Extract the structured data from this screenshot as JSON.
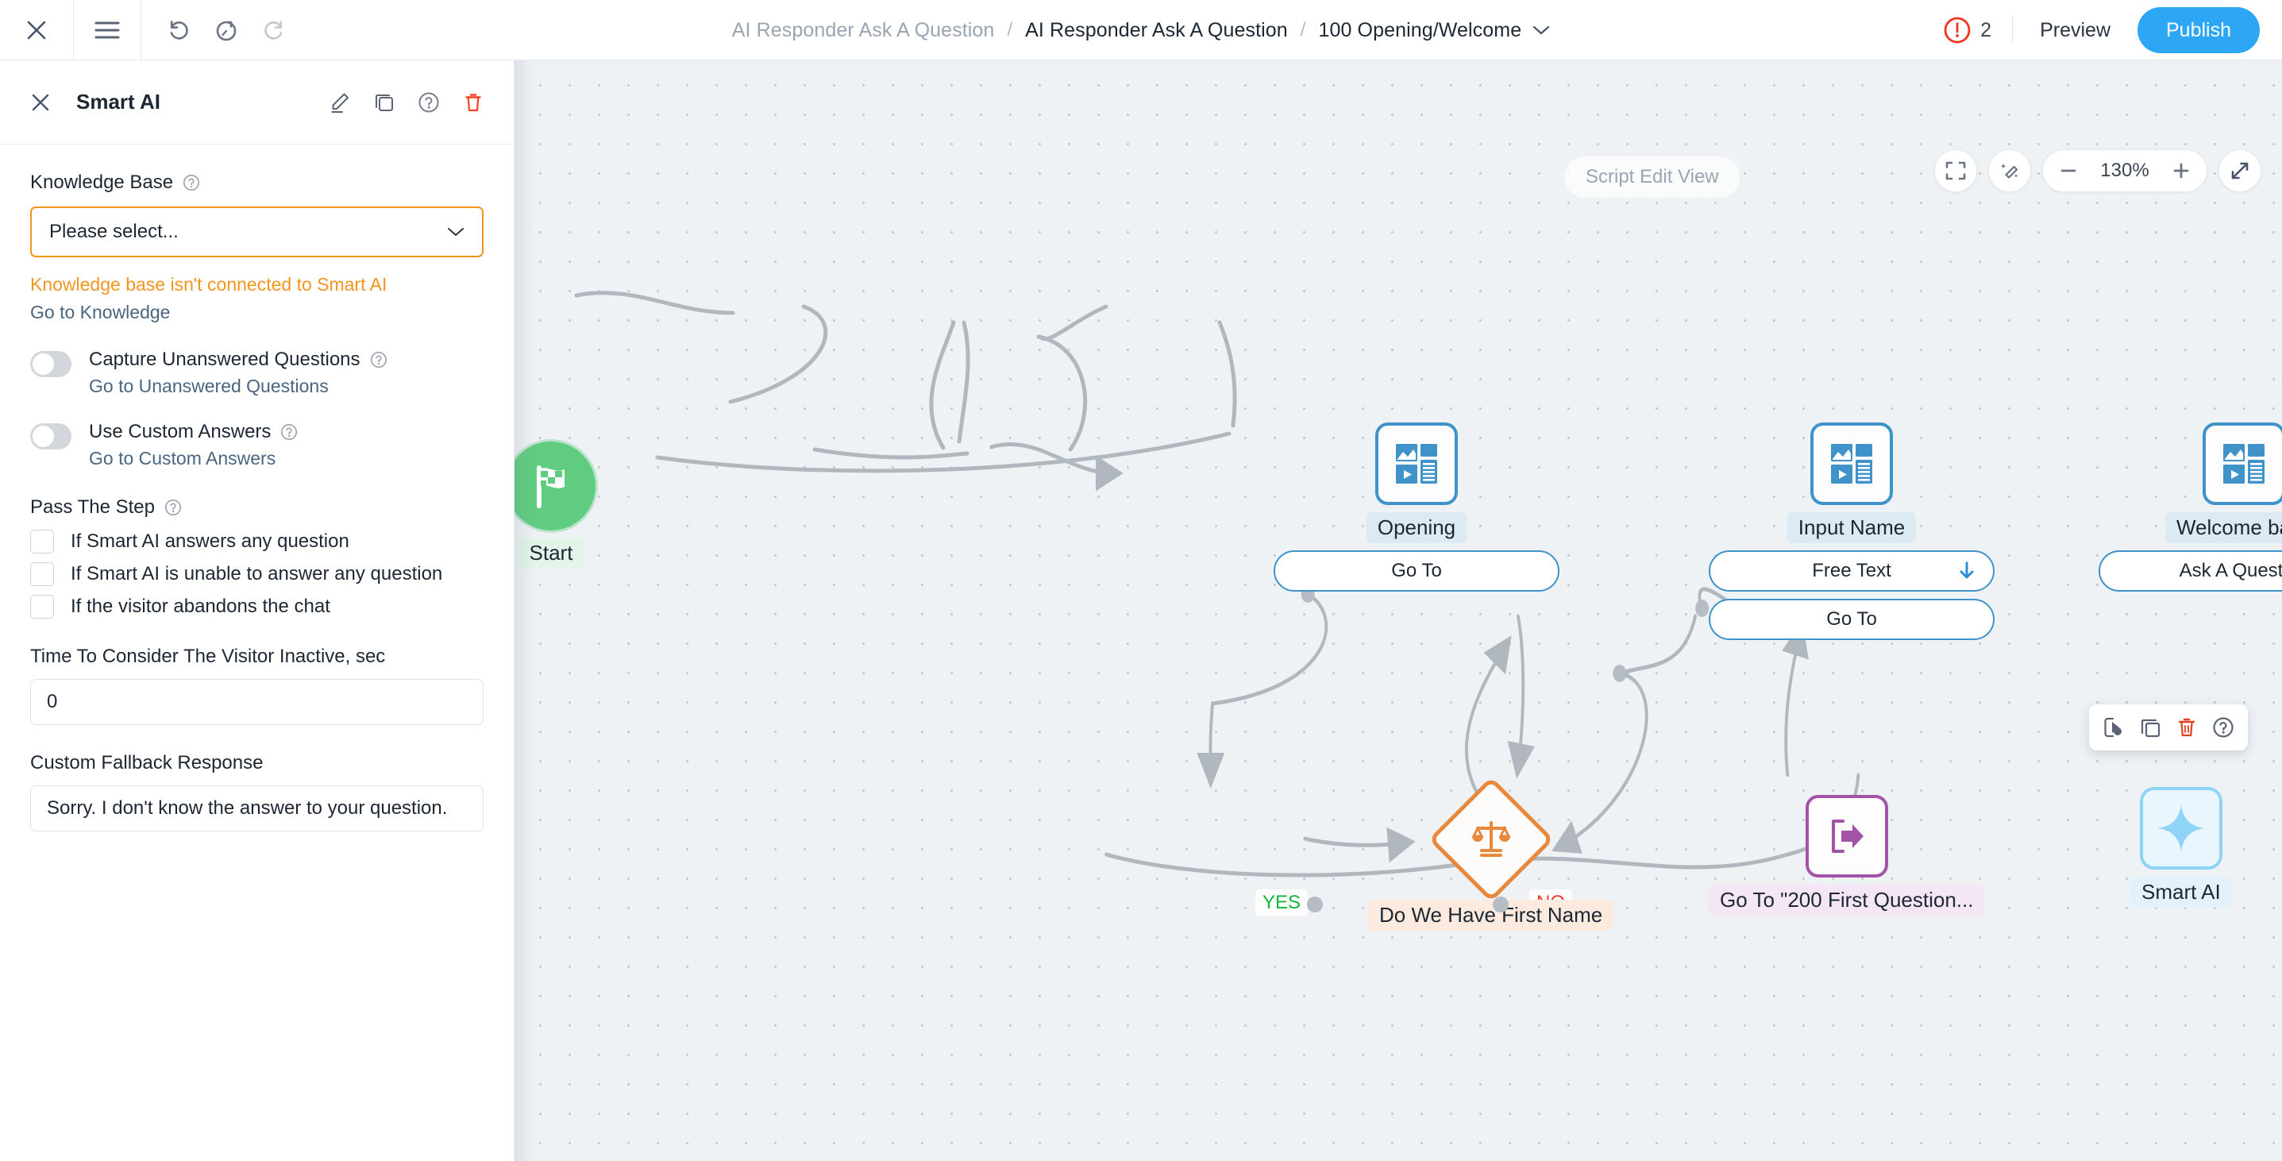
{
  "topbar": {
    "close_icon": "close-icon",
    "menu_icon": "hamburger-menu-icon",
    "undo_icon": "undo-icon",
    "history_icon": "revert-history-icon",
    "redo_icon": "redo-icon",
    "breadcrumb": [
      {
        "label": "AI Responder Ask A Question",
        "muted": true
      },
      {
        "label": "AI Responder Ask A Question",
        "muted": false
      },
      {
        "label": "100 Opening/Welcome",
        "muted": false
      }
    ],
    "breadcrumb_separator": "/",
    "error_count": "2",
    "error_icon": "error-exclamation-icon",
    "preview_label": "Preview",
    "publish_label": "Publish",
    "publish_color": "#2ca6f5",
    "error_color": "#f4351f"
  },
  "sidebar": {
    "title": "Smart AI",
    "close_icon": "close-icon",
    "actions": [
      {
        "name": "edit-icon"
      },
      {
        "name": "duplicate-icon"
      },
      {
        "name": "help-icon"
      },
      {
        "name": "delete-icon"
      }
    ],
    "knowledge_base": {
      "label": "Knowledge Base",
      "help_icon": "help-icon",
      "selected": "Please select...",
      "chevron_icon": "chevron-down-icon",
      "warning": "Knowledge base isn't connected to Smart AI",
      "warning_color": "#f5951e",
      "link": "Go to Knowledge"
    },
    "toggles": [
      {
        "label": "Capture Unanswered Questions",
        "help_icon": "help-icon",
        "sub_link": "Go to Unanswered Questions",
        "on": false
      },
      {
        "label": "Use Custom Answers",
        "help_icon": "help-icon",
        "sub_link": "Go to Custom Answers",
        "on": false
      }
    ],
    "pass_the_step": {
      "label": "Pass The Step",
      "help_icon": "help-icon",
      "options": [
        {
          "label": "If Smart AI answers any question",
          "checked": false
        },
        {
          "label": "If Smart AI is unable to answer any question",
          "checked": false
        },
        {
          "label": "If the visitor abandons the chat",
          "checked": false
        }
      ]
    },
    "inactive_time": {
      "label": "Time To Consider The Visitor Inactive, sec",
      "value": "0"
    },
    "fallback": {
      "label": "Custom Fallback Response",
      "value": "Sorry. I don't know the answer to your question."
    }
  },
  "canvas": {
    "script_badge": "Script Edit View",
    "tools": {
      "fit_icon": "fit-to-screen-icon",
      "autolayout_icon": "magic-wand-icon",
      "zoom_out_icon": "minus-icon",
      "zoom_value": "130%",
      "zoom_in_icon": "plus-icon",
      "expand_icon": "expand-diagonal-icon"
    },
    "node_toolbar": [
      {
        "name": "edit-icon"
      },
      {
        "name": "duplicate-icon"
      },
      {
        "name": "delete-icon"
      },
      {
        "name": "help-icon"
      }
    ],
    "nodes": {
      "start": {
        "label": "Start",
        "icon": "checkered-flag-icon",
        "color": "#5fcc7f"
      },
      "opening": {
        "label": "Opening",
        "icon": "rich-media-card-icon",
        "color": "#3f93c9",
        "buttons": [
          {
            "label": "Go To",
            "icon": null
          }
        ]
      },
      "input_name": {
        "label": "Input Name",
        "icon": "rich-media-card-icon",
        "color": "#3f93c9",
        "buttons": [
          {
            "label": "Free Text",
            "icon": "arrow-down-icon"
          },
          {
            "label": "Go To",
            "icon": null
          }
        ]
      },
      "welcome_back": {
        "label": "Welcome back",
        "icon": "rich-media-card-icon",
        "color": "#3f93c9",
        "buttons": [
          {
            "label": "Ask A Question",
            "icon": null
          }
        ]
      },
      "condition": {
        "label": "Do We Have First Name",
        "icon": "scales-balance-icon",
        "color": "#e8883c",
        "yes_label": "YES",
        "no_label": "NO",
        "yes_color": "#13b43c",
        "no_color": "#ef3b2d"
      },
      "goto": {
        "label": "Go To \"200 First Question...",
        "icon": "exit-arrow-icon",
        "color": "#a453a8"
      },
      "smart_ai": {
        "label": "Smart AI",
        "icon": "sparkle-star-icon",
        "color": "#8fd3f7"
      }
    }
  }
}
